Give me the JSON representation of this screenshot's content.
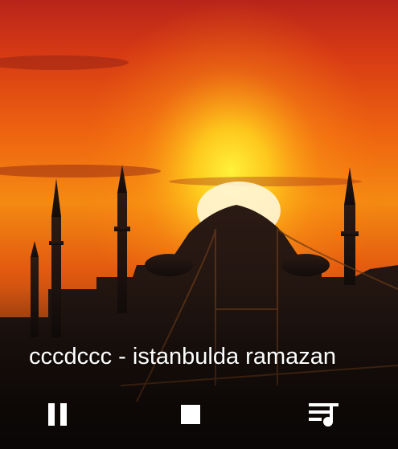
{
  "player": {
    "track_title": "cccdccc - istanbulda ramazan",
    "artwork": "sunset over mosque silhouette with minarets and bridge",
    "controls": {
      "pause_icon": "pause-icon",
      "stop_icon": "stop-icon",
      "queue_icon": "queue-music-icon"
    }
  },
  "colors": {
    "sky_top": "#c0301a",
    "sky_mid": "#f06a10",
    "sun": "#ffe820",
    "silhouette": "#1e1512",
    "text": "#ffffff"
  }
}
